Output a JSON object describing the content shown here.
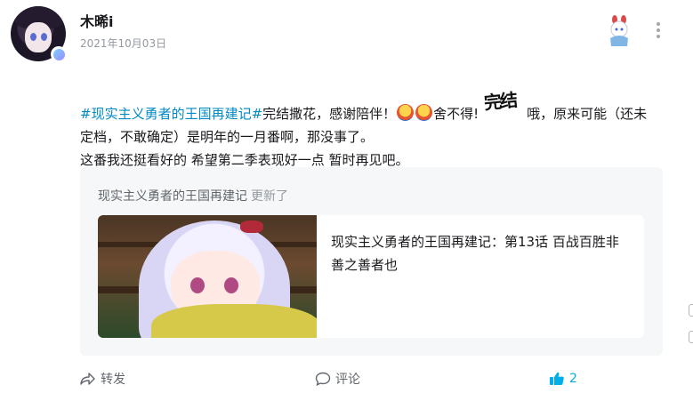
{
  "post": {
    "author": "木晞i",
    "date": "2021年10月03日",
    "topic": "#现实主义勇者的王国再建记#",
    "text_1": "完结撒花，感谢陪伴！",
    "text_2": "舍不得!",
    "emote_wanjie": "完结",
    "text_3": "哦，原来可能（还未定档，不敢确定）是明年的一月番啊，那没事了。",
    "text_4": "这番我还挺看好的 希望第二季表现好一点 暂时再见吧。"
  },
  "card": {
    "header_name": "现实主义勇者的王国再建记",
    "header_status": "更新了",
    "episode_title": "现实主义勇者的王国再建记：第13话 百战百胜非善之善者也"
  },
  "actions": {
    "forward_label": "转发",
    "comment_label": "评论",
    "like_count": "2"
  },
  "colors": {
    "topic_link": "#008ac5",
    "like_active": "#00aeec",
    "secondary_text": "#9499a0"
  }
}
